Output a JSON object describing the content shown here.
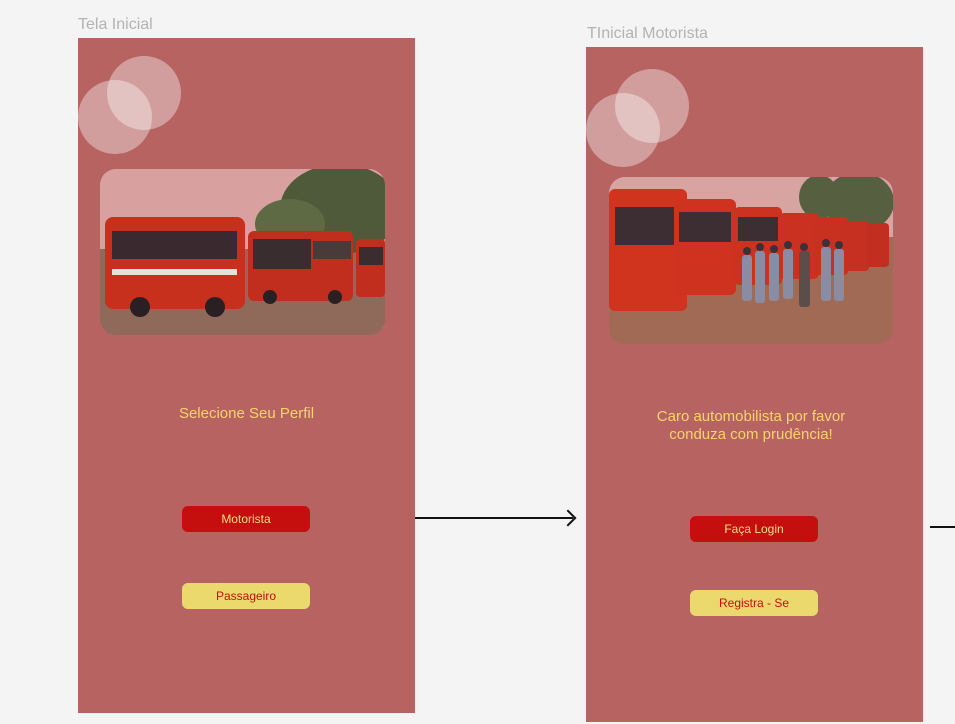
{
  "screens": [
    {
      "title": "Tela Inicial",
      "message": "Selecione Seu Perfil",
      "primary_button": "Motorista",
      "secondary_button": "Passageiro"
    },
    {
      "title": "TInicial Motorista",
      "message": "Caro automobilista por favor conduza com prudência!",
      "primary_button": "Faça Login",
      "secondary_button": "Registra - Se"
    }
  ],
  "colors": {
    "canvas": "#f4f4f4",
    "frame": "#b76362",
    "primary_button": "#c50f0f",
    "secondary_button": "#ebd96e",
    "message_text": "#f5d46b"
  },
  "images": [
    "red-buses-photo",
    "bus-fleet-with-drivers-photo"
  ]
}
